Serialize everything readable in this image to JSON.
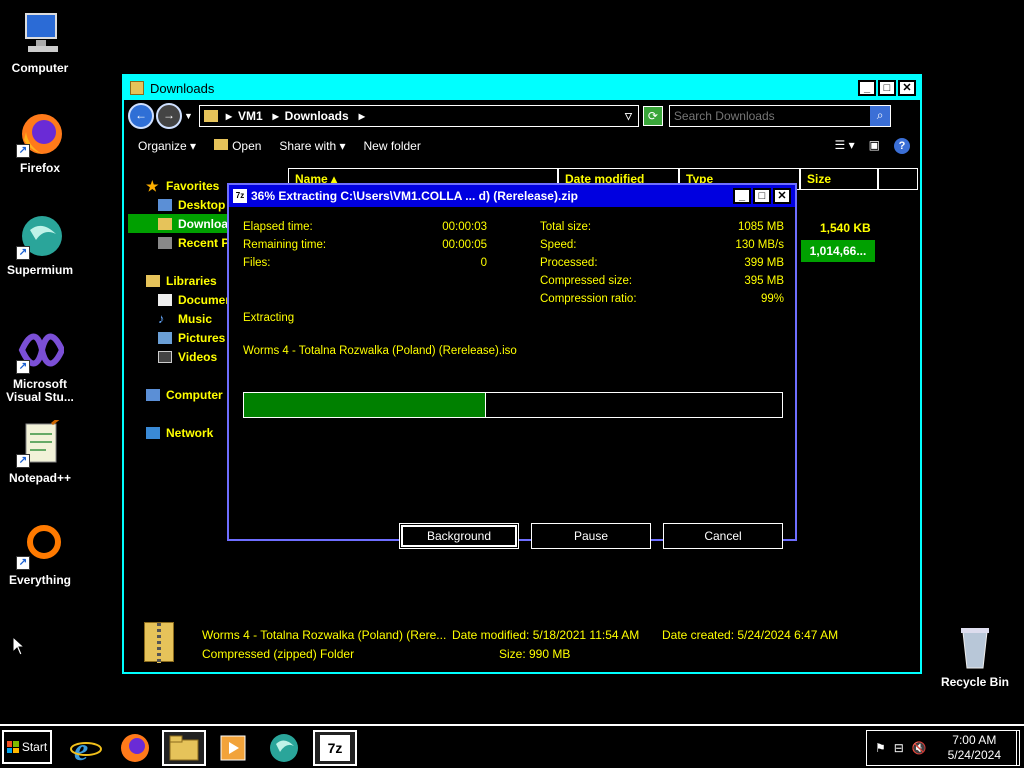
{
  "desktop": {
    "icons": [
      {
        "label": "Computer"
      },
      {
        "label": "Firefox"
      },
      {
        "label": "Supermium"
      },
      {
        "label": "Microsoft Visual Stu..."
      },
      {
        "label": "Notepad++"
      },
      {
        "label": "Everything"
      },
      {
        "label": "Recycle Bin"
      }
    ]
  },
  "explorer": {
    "title": "Downloads",
    "breadcrumb": [
      "VM1",
      "Downloads"
    ],
    "search_placeholder": "Search Downloads",
    "toolbar": {
      "organize": "Organize",
      "open": "Open",
      "share": "Share with",
      "new_folder": "New folder"
    },
    "nav": {
      "favorites": "Favorites",
      "desktop": "Desktop",
      "downloads": "Downloads",
      "recent": "Recent Places",
      "libraries": "Libraries",
      "documents": "Documents",
      "music": "Music",
      "pictures": "Pictures",
      "videos": "Videos",
      "computer": "Computer",
      "network": "Network"
    },
    "columns": {
      "name": "Name",
      "date": "Date modified",
      "type": "Type",
      "size": "Size"
    },
    "sizes": [
      "1,540 KB",
      "1,014,66..."
    ],
    "details": {
      "name": "Worms 4 - Totalna Rozwalka (Poland) (Rere...",
      "date_modified": "Date modified: 5/18/2021 11:54 AM",
      "date_created": "Date created: 5/24/2024 6:47 AM",
      "type": "Compressed (zipped) Folder",
      "size": "Size: 990 MB"
    }
  },
  "dialog": {
    "title": "36% Extracting C:\\Users\\VM1.COLLA ... d) (Rerelease).zip",
    "elapsed_label": "Elapsed time:",
    "elapsed": "00:00:03",
    "remaining_label": "Remaining time:",
    "remaining": "00:00:05",
    "files_label": "Files:",
    "files": "0",
    "total_label": "Total size:",
    "total": "1085 MB",
    "speed_label": "Speed:",
    "speed": "130 MB/s",
    "processed_label": "Processed:",
    "processed": "399 MB",
    "compressed_label": "Compressed size:",
    "compressed": "395 MB",
    "ratio_label": "Compression ratio:",
    "ratio": "99%",
    "status": "Extracting",
    "current_file": "Worms 4 - Totalna Rozwalka (Poland) (Rerelease).iso",
    "progress": 0.45,
    "buttons": {
      "background": "Background",
      "pause": "Pause",
      "cancel": "Cancel"
    }
  },
  "taskbar": {
    "start": "Start",
    "time": "7:00 AM",
    "date": "5/24/2024"
  }
}
